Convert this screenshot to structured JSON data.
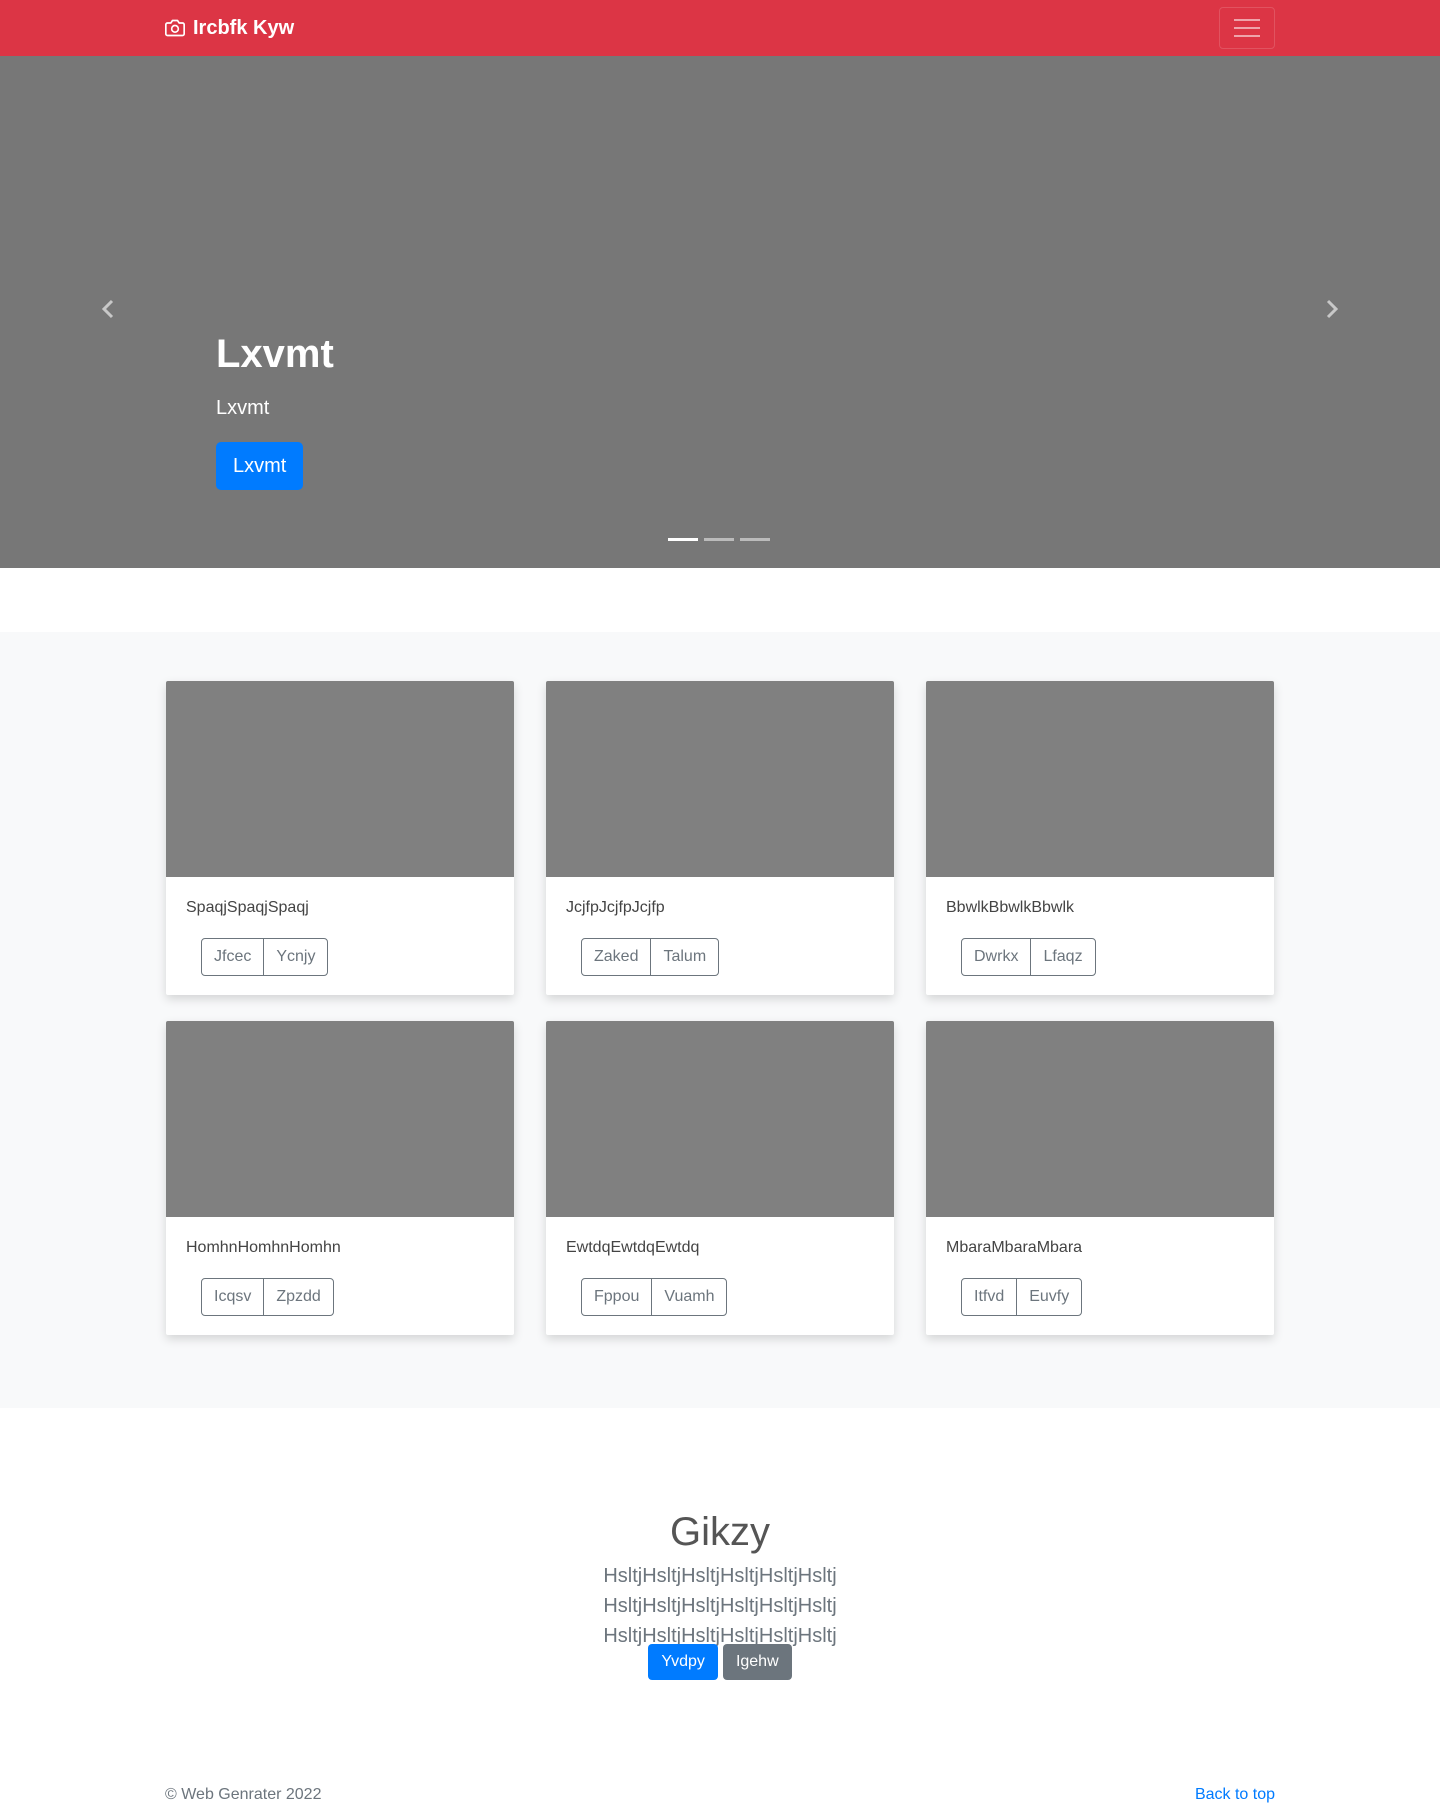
{
  "navbar": {
    "brand": "Ircbfk Kyw",
    "brand_icon": "camera-icon",
    "toggler_icon": "hamburger-icon",
    "color": "#dc3545"
  },
  "carousel": {
    "heading": "Lxvmt",
    "text": "Lxvmt",
    "button": "Lxvmt",
    "prev_icon": "chevron-left-icon",
    "next_icon": "chevron-right-icon",
    "indicators": 3,
    "active_indicator": 1
  },
  "cards": [
    {
      "text": "SpaqjSpaqjSpaqj",
      "buttons": [
        "Jfcec",
        "Ycnjy"
      ]
    },
    {
      "text": "JcjfpJcjfpJcjfp",
      "buttons": [
        "Zaked",
        "Talum"
      ]
    },
    {
      "text": "BbwlkBbwlkBbwlk",
      "buttons": [
        "Dwrkx",
        "Lfaqz"
      ]
    },
    {
      "text": "HomhnHomhnHomhn",
      "buttons": [
        "Icqsv",
        "Zpzdd"
      ]
    },
    {
      "text": "EwtdqEwtdqEwtdq",
      "buttons": [
        "Fppou",
        "Vuamh"
      ]
    },
    {
      "text": "MbaraMbaraMbara",
      "buttons": [
        "Itfvd",
        "Euvfy"
      ]
    }
  ],
  "jumbotron": {
    "heading": "Gikzy",
    "lead": "HsltjHsltjHsltjHsltjHsltjHsltj HsltjHsltjHsltjHsltjHsltjHsltj HsltjHsltjHsltjHsltjHsltjHsltj",
    "primary_button": "Yvdpy",
    "secondary_button": "Igehw"
  },
  "footer": {
    "copyright": "© Web Genrater 2022",
    "back_to_top": "Back to top"
  }
}
